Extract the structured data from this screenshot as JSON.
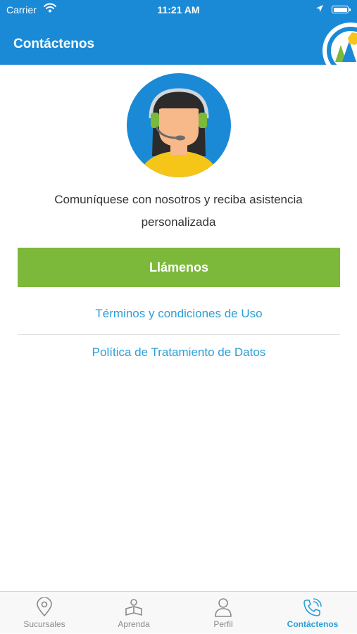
{
  "status_bar": {
    "carrier": "Carrier",
    "time": "11:21 AM"
  },
  "header": {
    "title": "Contáctenos"
  },
  "main": {
    "message": "Comuníquese con nosotros y reciba asistencia personalizada",
    "call_button_label": "Llámenos",
    "terms_link": "Términos y condiciones de Uso",
    "privacy_link": "Política de Tratamiento de Datos"
  },
  "tab_bar": {
    "tabs": [
      {
        "label": "Sucursales",
        "icon": "location-pin-icon",
        "active": false
      },
      {
        "label": "Aprenda",
        "icon": "reading-person-icon",
        "active": false
      },
      {
        "label": "Perfil",
        "icon": "user-icon",
        "active": false
      },
      {
        "label": "Contáctenos",
        "icon": "phone-ringing-icon",
        "active": true
      }
    ]
  },
  "colors": {
    "header": "#1b8ad6",
    "call_button": "#7cb83a",
    "link": "#2a9fd8",
    "tab_active": "#2a9fd8",
    "tab_inactive": "#8a8a8a"
  }
}
